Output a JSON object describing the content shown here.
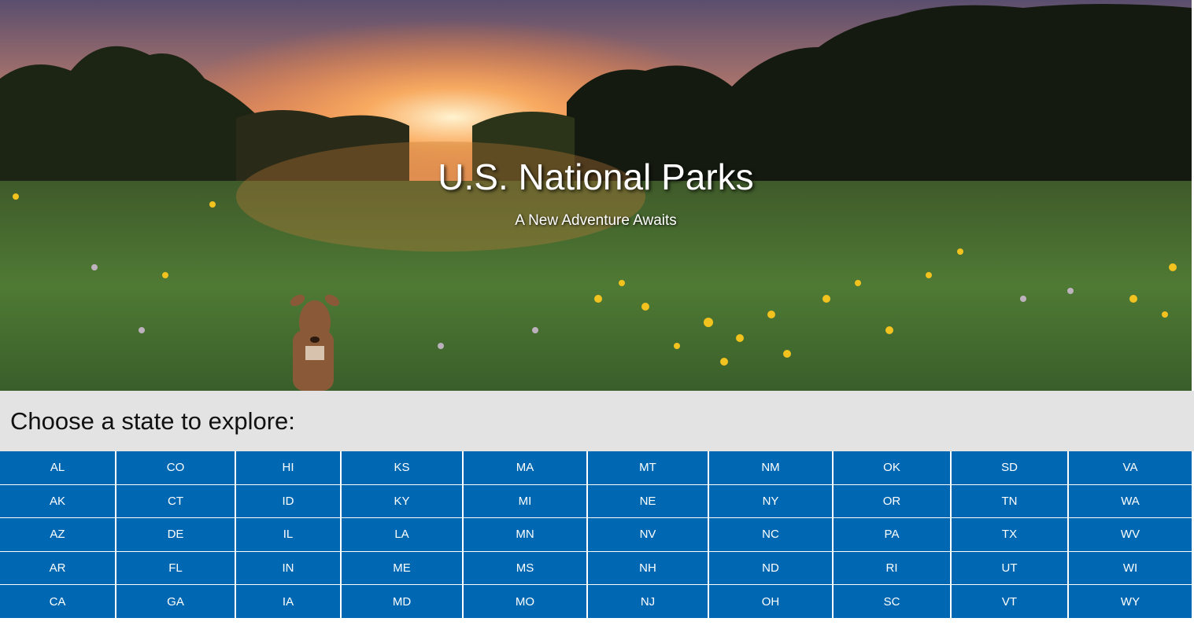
{
  "hero": {
    "title": "U.S. National Parks",
    "subtitle": "A New Adventure Awaits",
    "image": "meadow-sunset-with-deer"
  },
  "prompt": "Choose a state to explore:",
  "colors": {
    "button_bg": "#0068b2",
    "button_text": "#ffffff",
    "prompt_bg": "#e3e3e3"
  },
  "states": [
    [
      "AL",
      "CO",
      "HI",
      "KS",
      "MA",
      "MT",
      "NM",
      "OK",
      "SD",
      "VA"
    ],
    [
      "AK",
      "CT",
      "ID",
      "KY",
      "MI",
      "NE",
      "NY",
      "OR",
      "TN",
      "WA"
    ],
    [
      "AZ",
      "DE",
      "IL",
      "LA",
      "MN",
      "NV",
      "NC",
      "PA",
      "TX",
      "WV"
    ],
    [
      "AR",
      "FL",
      "IN",
      "ME",
      "MS",
      "NH",
      "ND",
      "RI",
      "UT",
      "WI"
    ],
    [
      "CA",
      "GA",
      "IA",
      "MD",
      "MO",
      "NJ",
      "OH",
      "SC",
      "VT",
      "WY"
    ]
  ]
}
